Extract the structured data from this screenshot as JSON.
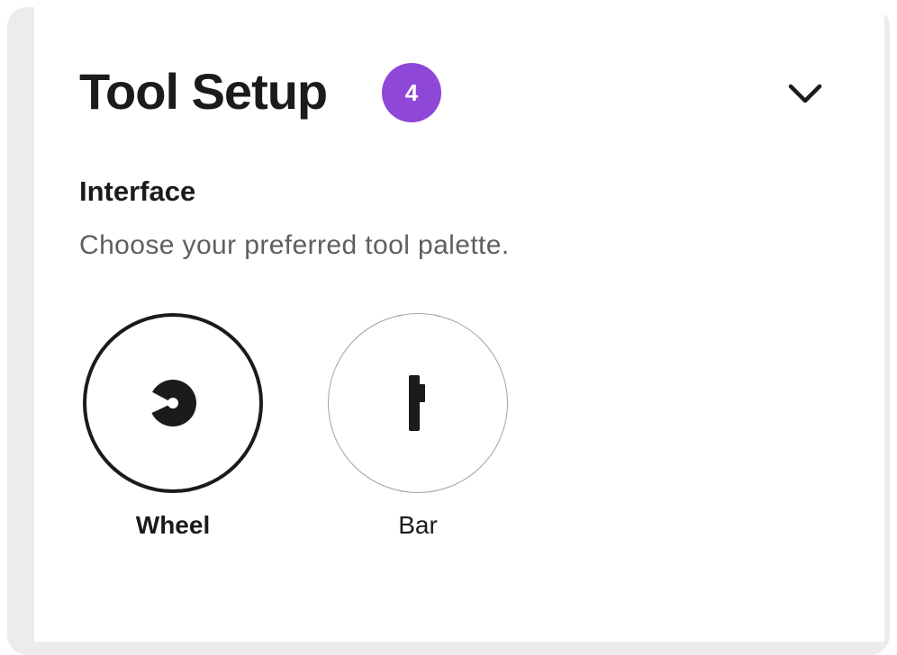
{
  "header": {
    "title": "Tool Setup",
    "badge_count": "4",
    "collapse_icon": "chevron-down-icon"
  },
  "section": {
    "label": "Interface",
    "description": "Choose your preferred tool palette."
  },
  "palette_options": [
    {
      "label": "Wheel",
      "icon": "wheel-icon",
      "selected": true
    },
    {
      "label": "Bar",
      "icon": "bar-icon",
      "selected": false
    }
  ],
  "colors": {
    "badge": "#8e47d6",
    "text": "#1b1b1b",
    "muted_text": "#5f5f5f",
    "selected_border": "#1b1b1b",
    "unselected_border": "#9aa3a1",
    "background_strip": "#ececec"
  }
}
